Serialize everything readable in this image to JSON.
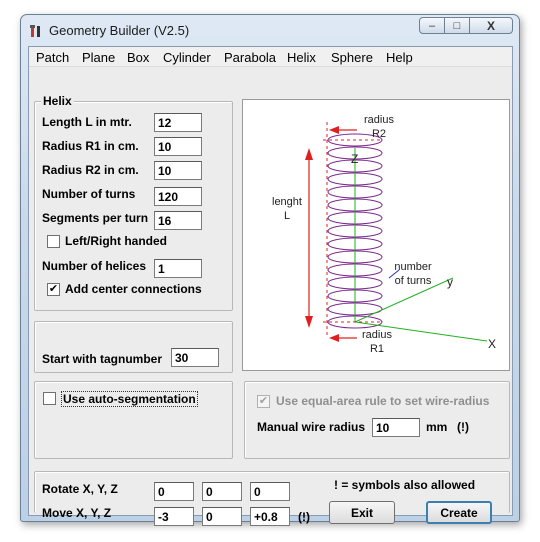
{
  "window": {
    "title": "Geometry Builder (V2.5)",
    "controls": {
      "minimize": "–",
      "maximize": "□",
      "close": "X"
    }
  },
  "menu": [
    "Patch",
    "Plane",
    "Box",
    "Cylinder",
    "Parabola",
    "Helix",
    "Sphere",
    "Help"
  ],
  "helix": {
    "group_label": "Helix",
    "length_label": "Length L in mtr.",
    "length_value": "12",
    "r1_label": "Radius R1 in cm.",
    "r1_value": "10",
    "r2_label": "Radius R2 in cm.",
    "r2_value": "10",
    "turns_label": "Number of turns",
    "turns_value": "120",
    "segments_label": "Segments per turn",
    "segments_value": "16",
    "handed_label": "Left/Right handed",
    "handed_checked": "",
    "helices_label": "Number of helices",
    "helices_value": "1",
    "center_label": "Add center connections",
    "center_checked": "✔"
  },
  "tag": {
    "label": "Start with tagnumber",
    "value": "30"
  },
  "autoseg": {
    "label": "Use auto-segmentation",
    "checked": ""
  },
  "wire": {
    "equal_area_label": "Use equal-area rule to set wire-radius",
    "equal_area_checked": "✔",
    "manual_label": "Manual wire radius",
    "manual_value": "10",
    "unit": "mm",
    "hint": "(!)"
  },
  "transform": {
    "rotate_label": "Rotate X, Y, Z",
    "rotate": [
      "0",
      "0",
      "0"
    ],
    "move_label": "Move X, Y, Z",
    "move": [
      "-3",
      "0",
      "+0.8"
    ],
    "hint": "(!)",
    "note": "! =  symbols also allowed"
  },
  "buttons": {
    "exit": "Exit",
    "create": "Create"
  },
  "diagram": {
    "radius2": [
      "radius",
      "R2"
    ],
    "length": [
      "lenght",
      "L"
    ],
    "turns": [
      "number",
      "of turns"
    ],
    "radius1": [
      "radius",
      "R1"
    ],
    "axis_z": "Z",
    "axis_y": "y",
    "axis_x": "X"
  },
  "colors": {
    "coil": "#7b2a8c",
    "arrow": "#e02020",
    "axis": "#22b022",
    "axis_blue": "#2233cc"
  }
}
